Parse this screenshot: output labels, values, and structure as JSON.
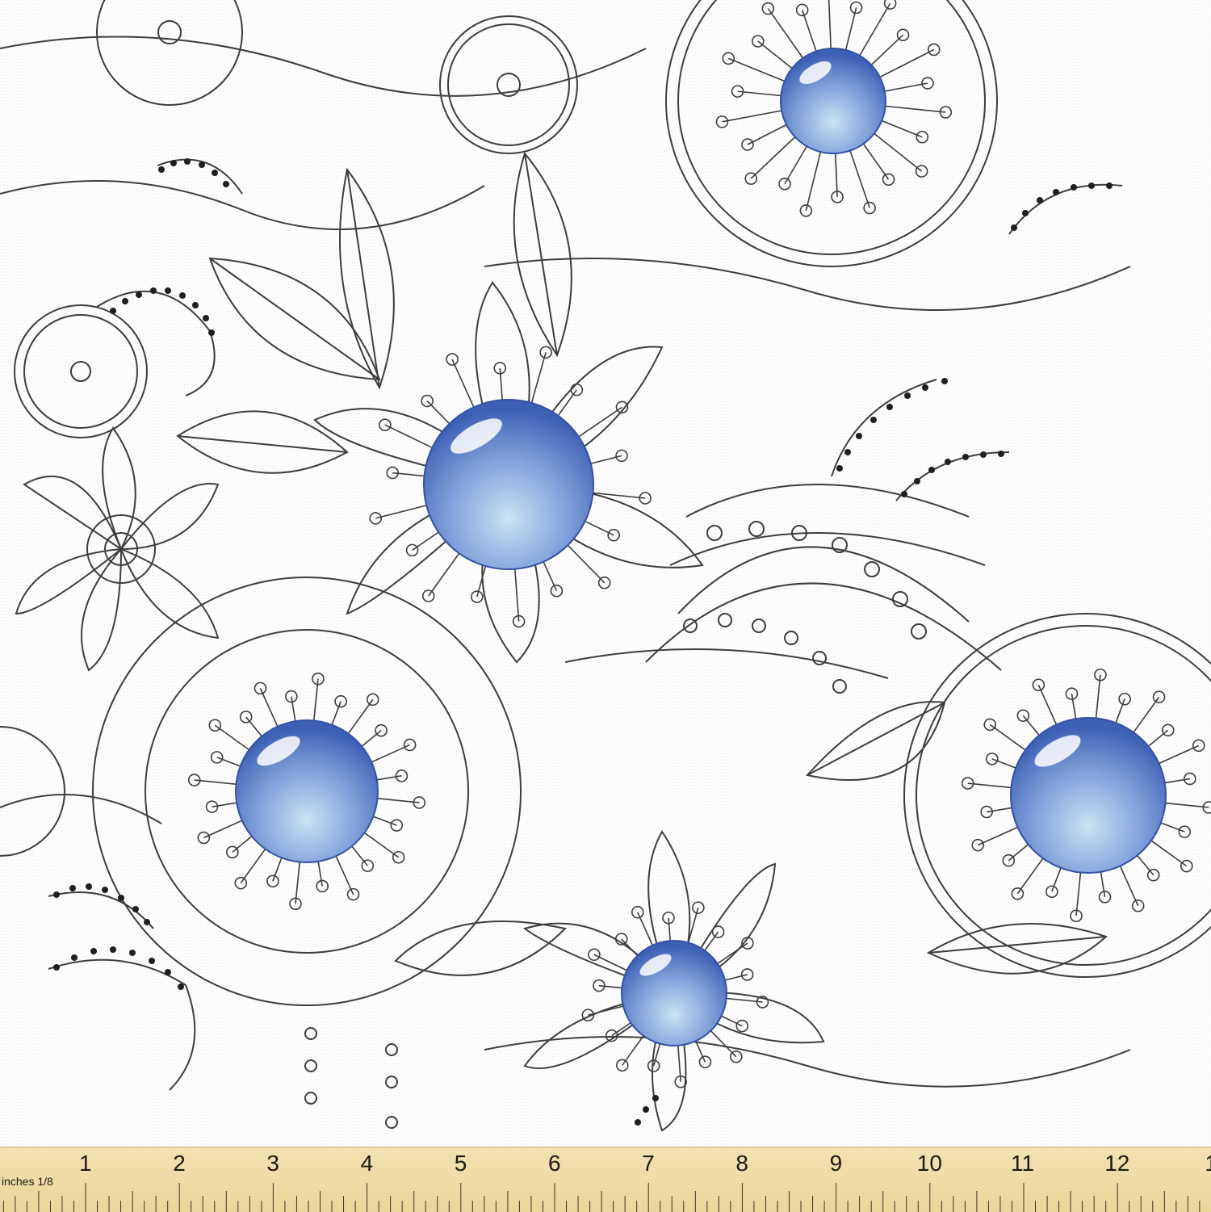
{
  "fabric": {
    "background": "#fdfdfd",
    "line_color": "#3d3d3d",
    "accent_color": "#5b7fce",
    "accent_highlight": "#c8e4f4"
  },
  "ruler": {
    "unit_label": "inches 1/8",
    "numbers": [
      "1",
      "2",
      "3",
      "4",
      "5",
      "6",
      "7",
      "8",
      "9",
      "10",
      "11",
      "12",
      "1"
    ],
    "color": "#ecd59b"
  }
}
